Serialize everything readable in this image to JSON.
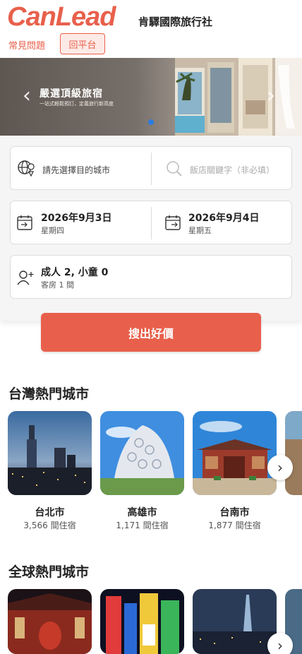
{
  "header": {
    "logo_text": "CanLead",
    "company_name": "肯驛國際旅行社",
    "faq_label": "常見問題",
    "back_label": "回平台"
  },
  "banner": {
    "title": "嚴選頂級旅宿",
    "subtitle": "一站式輕鬆預訂，定義旅行新高度",
    "prev_icon": "chevron-left-icon",
    "next_icon": "chevron-right-icon",
    "active_slide": 1
  },
  "search": {
    "destination_placeholder": "請先選擇目的城市",
    "keyword_placeholder": "飯店關鍵字（非必填）",
    "checkin_date": "2026年9月3日",
    "checkin_weekday": "星期四",
    "checkout_date": "2026年9月4日",
    "checkout_weekday": "星期五",
    "guests_summary": "成人 2, 小童 0",
    "rooms_summary": "客房 1 間",
    "button_label": "搜出好價"
  },
  "taiwan": {
    "title": "台灣熱門城市",
    "cities": [
      {
        "name": "台北市",
        "count": "3,566 間住宿"
      },
      {
        "name": "高雄市",
        "count": "1,171 間住宿"
      },
      {
        "name": "台南市",
        "count": "1,877 間住宿"
      }
    ]
  },
  "global": {
    "title": "全球熱門城市"
  },
  "colors": {
    "brand": "#e8604c",
    "panel_bg": "#f5f5f5"
  }
}
